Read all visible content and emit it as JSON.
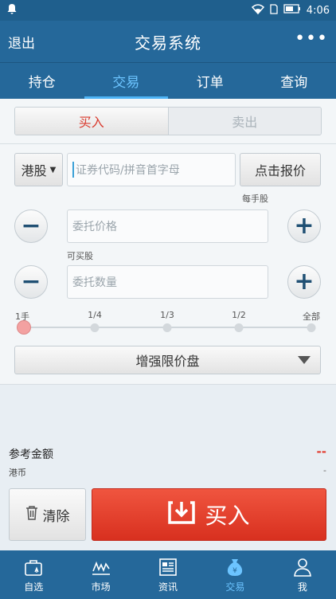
{
  "status": {
    "time": "4:06"
  },
  "header": {
    "back": "退出",
    "title": "交易系统",
    "more": "•••"
  },
  "tabs": [
    {
      "label": "持仓"
    },
    {
      "label": "交易"
    },
    {
      "label": "订单"
    },
    {
      "label": "查询"
    }
  ],
  "side_toggle": {
    "buy": "买入",
    "sell": "卖出"
  },
  "market": {
    "selected": "港股"
  },
  "code_input": {
    "placeholder": "证券代码/拼音首字母"
  },
  "quote_button": "点击报价",
  "lot_label": "每手股",
  "price_field": {
    "placeholder": "委托价格"
  },
  "available_label": "可买股",
  "qty_field": {
    "placeholder": "委托数量"
  },
  "slider": {
    "labels": [
      "1手",
      "1/4",
      "1/3",
      "1/2",
      "全部"
    ],
    "selected_index": 0
  },
  "order_type": {
    "selected": "增强限价盘"
  },
  "reference": {
    "label": "参考金额",
    "value": "--",
    "currency": "港币",
    "currency_value": "-"
  },
  "actions": {
    "clear": "清除",
    "buy": "买入"
  },
  "bottom_nav": [
    {
      "label": "自选",
      "icon": "watchlist-icon"
    },
    {
      "label": "市场",
      "icon": "market-chart-icon"
    },
    {
      "label": "资讯",
      "icon": "news-icon"
    },
    {
      "label": "交易",
      "icon": "trade-money-bag-icon"
    },
    {
      "label": "我",
      "icon": "profile-icon"
    }
  ],
  "colors": {
    "header": "#25689a",
    "accent": "#4db3f5",
    "buy": "#d93a2e"
  }
}
